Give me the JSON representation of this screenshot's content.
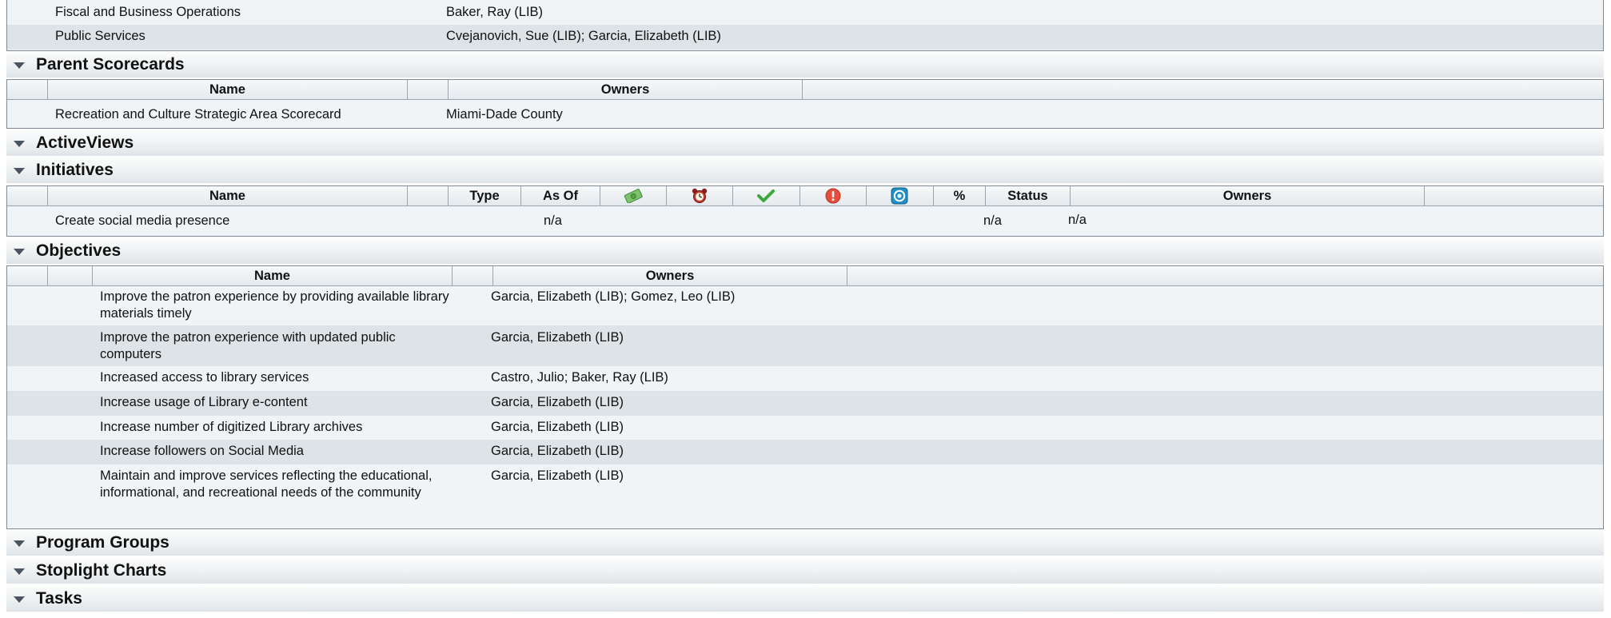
{
  "top_table": {
    "rows": [
      {
        "name": "Fiscal and Business Operations",
        "owners": "Baker, Ray (LIB)"
      },
      {
        "name": "Public Services",
        "owners": "Cvejanovich, Sue (LIB); Garcia, Elizabeth (LIB)"
      }
    ]
  },
  "parent_scorecards": {
    "title": "Parent Scorecards",
    "headers": {
      "name": "Name",
      "owners": "Owners"
    },
    "rows": [
      {
        "name": "Recreation and Culture Strategic Area Scorecard",
        "owners": "Miami-Dade County"
      }
    ]
  },
  "active_views": {
    "title": "ActiveViews"
  },
  "initiatives": {
    "title": "Initiatives",
    "headers": {
      "name": "Name",
      "type": "Type",
      "as_of": "As Of",
      "percent": "%",
      "status": "Status",
      "owners": "Owners"
    },
    "header_icons": [
      "money-icon",
      "alarm-clock-icon",
      "checkmark-icon",
      "warning-icon",
      "target-icon"
    ],
    "rows": [
      {
        "name": "Create social media presence",
        "as_of": "n/a",
        "status": "n/a",
        "owners": "n/a"
      }
    ]
  },
  "objectives": {
    "title": "Objectives",
    "headers": {
      "name": "Name",
      "owners": "Owners"
    },
    "rows": [
      {
        "name": "Improve the patron experience by providing available library materials timely",
        "owners": "Garcia, Elizabeth (LIB); Gomez, Leo (LIB)"
      },
      {
        "name": "Improve the patron experience with updated public computers",
        "owners": "Garcia, Elizabeth (LIB)"
      },
      {
        "name": "Increased access to library services",
        "owners": "Castro, Julio; Baker, Ray (LIB)"
      },
      {
        "name": "Increase usage of Library e-content",
        "owners": "Garcia, Elizabeth (LIB)"
      },
      {
        "name": "Increase number of digitized Library archives",
        "owners": "Garcia, Elizabeth (LIB)"
      },
      {
        "name": "Increase followers on Social Media",
        "owners": "Garcia, Elizabeth (LIB)"
      },
      {
        "name": "Maintain and improve services reflecting the educational, informational, and recreational needs of the community",
        "owners": "Garcia, Elizabeth (LIB)"
      }
    ]
  },
  "program_groups": {
    "title": "Program Groups"
  },
  "stoplight_charts": {
    "title": "Stoplight Charts"
  },
  "tasks": {
    "title": "Tasks"
  },
  "colors": {
    "border": "#7d8a96",
    "row_light": "#f0f4f7",
    "row_alt": "#dde3e7",
    "money_green": "#5cb85c",
    "clock_red": "#c0392b",
    "check_green": "#3aa83a",
    "warning_red": "#e74c3c",
    "target_blue": "#1f8fc4"
  }
}
